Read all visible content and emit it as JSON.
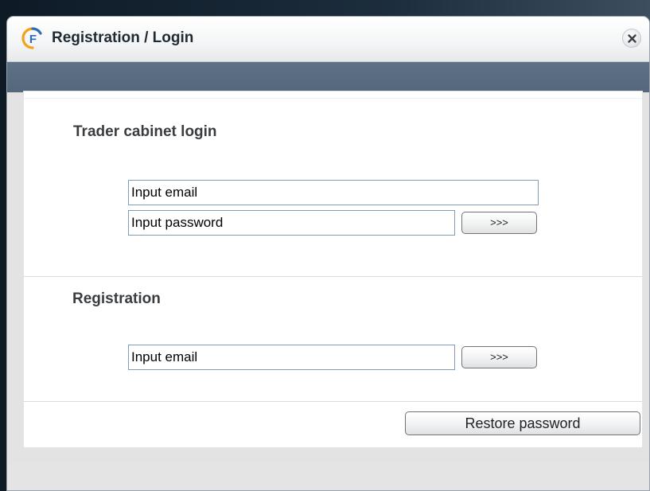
{
  "window": {
    "title": "Registration / Login",
    "close_icon": "close-icon",
    "logo_icon": "app-logo-icon",
    "logo_letter": "F"
  },
  "login": {
    "heading": "Trader cabinet login",
    "email_value": "Input email",
    "password_value": "Input password",
    "submit_label": ">>>"
  },
  "registration": {
    "heading": "Registration",
    "email_value": "Input email",
    "submit_label": ">>>"
  },
  "restore": {
    "label": "Restore password"
  },
  "colors": {
    "dark_bar": "#55677b",
    "logo_orange": "#f5a01a",
    "logo_blue": "#2b6cb3"
  }
}
